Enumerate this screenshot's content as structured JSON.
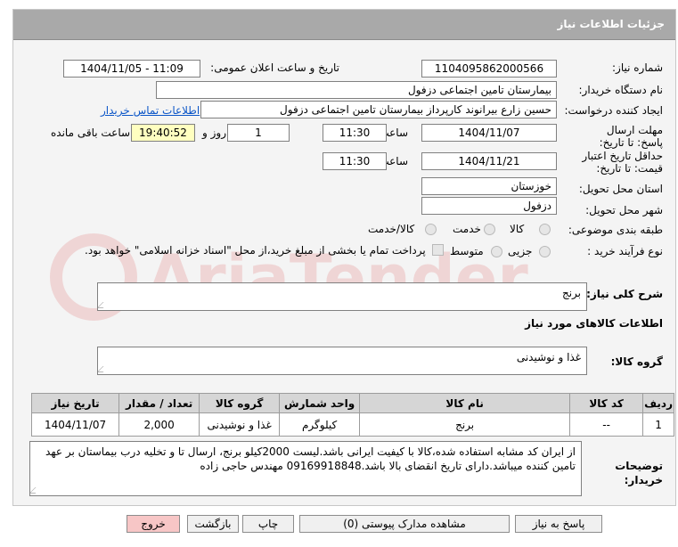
{
  "title": "جزئیات اطلاعات نیاز",
  "fields": {
    "need_number_label": "شماره نیاز:",
    "need_number": "1104095862000566",
    "announce_label": "تاریخ و ساعت اعلان عمومی:",
    "announce_value": "1404/11/05 - 11:09",
    "buyer_org_label": "نام دستگاه خریدار:",
    "buyer_org": "بیمارستان تامین اجتماعی دزفول",
    "creator_label": "ایجاد کننده درخواست:",
    "creator": "حسین زارع بیرانوند کارپرداز بیمارستان تامین اجتماعی دزفول",
    "contact_link": "اطلاعات تماس خریدار",
    "reply_deadline_label": "مهلت ارسال پاسخ: تا تاریخ:",
    "reply_date": "1404/11/07",
    "time_label": "ساعت",
    "reply_time": "11:30",
    "days": "1",
    "days_label": "روز و",
    "remaining_time": "19:40:52",
    "remaining_label": "ساعت باقی مانده",
    "validity_label": "حداقل تاریخ اعتبار قیمت: تا تاریخ:",
    "validity_date": "1404/11/21",
    "validity_time": "11:30",
    "province_label": "استان محل تحویل:",
    "province": "خوزستان",
    "city_label": "شهر محل تحویل:",
    "city": "دزفول",
    "category_label": "طبقه بندی موضوعی:",
    "category_options": [
      "کالا",
      "خدمت",
      "کالا/خدمت"
    ],
    "process_label": "نوع فرآیند خرید :",
    "process_options": [
      "جزیی",
      "متوسط"
    ],
    "payment_note": "پرداخت تمام یا بخشی از مبلغ خرید،از محل \"اسناد خزانه اسلامی\" خواهد بود."
  },
  "summary_label": "شرح کلی نیاز:",
  "summary": "برنج",
  "goods_info_label": "اطلاعات کالاهای مورد نیاز",
  "goods_group_label": "گروه کالا:",
  "goods_group": "غذا و نوشیدنی",
  "table": {
    "headers": [
      "ردیف",
      "کد کالا",
      "نام کالا",
      "واحد شمارش",
      "گروه کالا",
      "تعداد / مقدار",
      "تاریخ نیاز"
    ],
    "rows": [
      [
        "1",
        "--",
        "برنج",
        "کیلوگرم",
        "غذا و نوشیدنی",
        "2,000",
        "1404/11/07"
      ]
    ]
  },
  "buyer_notes_label": "توضیحات خریدار:",
  "buyer_notes": "از ایران کد مشابه استفاده شده،کالا با کیفیت ایرانی باشد.لیست 2000کیلو برنج، ارسال تا و تخلیه درب بیماستان بر عهد تامین کننده میباشد.دارای تاریخ انقضای بالا باشد.09169918848 مهندس حاجی زاده",
  "buttons": {
    "reply": "پاسخ به نیاز",
    "attachments": "مشاهده مدارک پیوستی (0)",
    "print": "چاپ",
    "back": "بازگشت",
    "exit": "خروج"
  },
  "watermark": "AriaTender.neT"
}
